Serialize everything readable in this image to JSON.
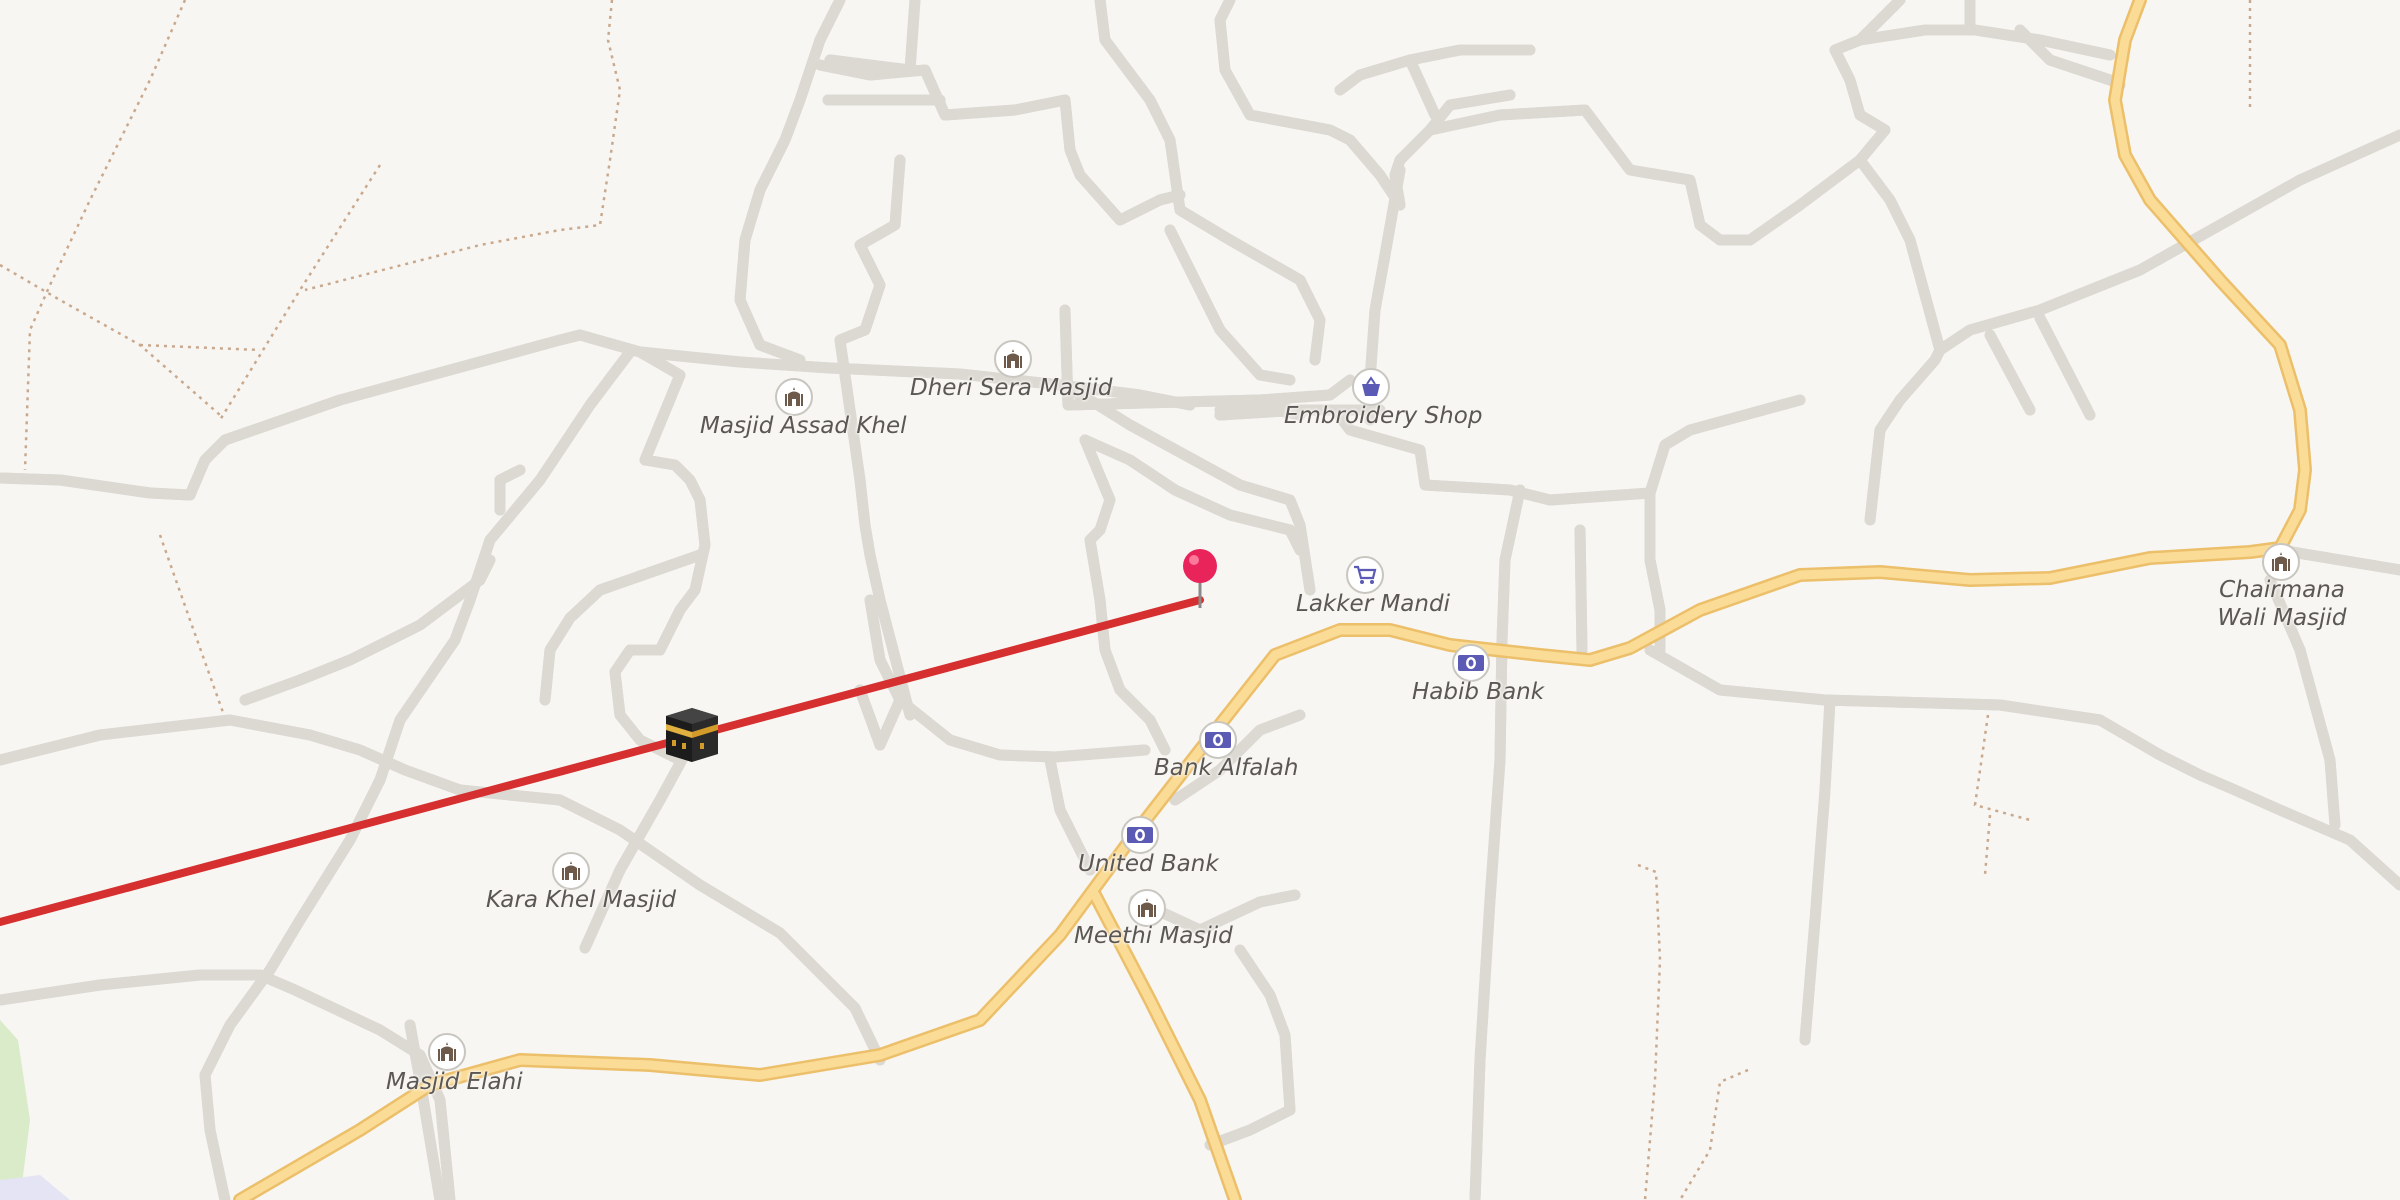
{
  "map": {
    "colors": {
      "background": "#f8f6f2",
      "minor_road": "#ffffff",
      "road_casing": "#dcd9d3",
      "major_road": "#fbdc96",
      "major_road_casing": "#ecbf6a",
      "path": "#c9a98e",
      "qibla_line": "#d62f2f",
      "pin": "#e8245a",
      "park": "#d9ebc9",
      "poi_religion": "#6d5a4a",
      "poi_commerce": "#5b5bb5"
    },
    "direction_line": {
      "from": "kaaba-icon",
      "to": "location-pin-icon"
    },
    "pois": [
      {
        "id": "dheri-sera-masjid",
        "label": "Dheri Sera Masjid",
        "icon": "mosque-icon"
      },
      {
        "id": "masjid-assad-khel",
        "label": "Masjid Assad Khel",
        "icon": "mosque-icon"
      },
      {
        "id": "embroidery-shop",
        "label": "Embroidery Shop",
        "icon": "shopping-basket-icon"
      },
      {
        "id": "lakker-mandi",
        "label": "Lakker Mandi",
        "icon": "shopping-cart-icon"
      },
      {
        "id": "habib-bank",
        "label": "Habib Bank",
        "icon": "bank-note-icon"
      },
      {
        "id": "bank-alfalah",
        "label": "Bank Alfalah",
        "icon": "bank-note-icon"
      },
      {
        "id": "united-bank",
        "label": "United Bank",
        "icon": "bank-note-icon"
      },
      {
        "id": "meethi-masjid",
        "label": "Meethi Masjid",
        "icon": "mosque-icon"
      },
      {
        "id": "kara-khel-masjid",
        "label": "Kara Khel Masjid",
        "icon": "mosque-icon"
      },
      {
        "id": "masjid-elahi",
        "label": "Masjid Elahi",
        "icon": "mosque-icon"
      },
      {
        "id": "chairmana-wali-masjid",
        "label": "Chairmana Wali Masjid",
        "icon": "mosque-icon"
      }
    ],
    "markers": {
      "kaaba": {
        "icon": "kaaba-icon"
      },
      "pin": {
        "icon": "location-pin-icon"
      }
    }
  }
}
